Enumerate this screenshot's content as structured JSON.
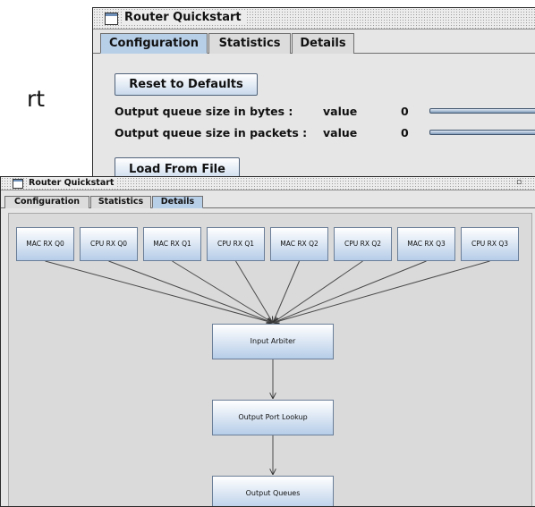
{
  "slide_fragment": "rt",
  "back_window": {
    "title": "Router Quickstart",
    "tabs": [
      {
        "label": "Configuration",
        "active": true
      },
      {
        "label": "Statistics",
        "active": false
      },
      {
        "label": "Details",
        "active": false
      }
    ],
    "reset_button": "Reset to Defaults",
    "rows": [
      {
        "label": "Output queue size in bytes :",
        "value_label": "value",
        "value": "0"
      },
      {
        "label": "Output queue size in packets :",
        "value_label": "value",
        "value": "0"
      }
    ],
    "load_button": "Load From File"
  },
  "front_window": {
    "title": "Router Quickstart",
    "tabs": [
      {
        "label": "Configuration",
        "active": false
      },
      {
        "label": "Statistics",
        "active": false
      },
      {
        "label": "Details",
        "active": true
      }
    ],
    "queues": [
      "MAC RX Q0",
      "CPU RX Q0",
      "MAC RX Q1",
      "CPU RX Q1",
      "MAC RX Q2",
      "CPU RX Q2",
      "MAC RX Q3",
      "CPU RX Q3"
    ],
    "pipeline": [
      "Input Arbiter",
      "Output Port Lookup",
      "Output Queues"
    ]
  },
  "colors": {
    "active_tab": "#b8cfe8",
    "node_gradient_bottom": "#b6cde8",
    "window_bg": "#e6e6e6"
  }
}
